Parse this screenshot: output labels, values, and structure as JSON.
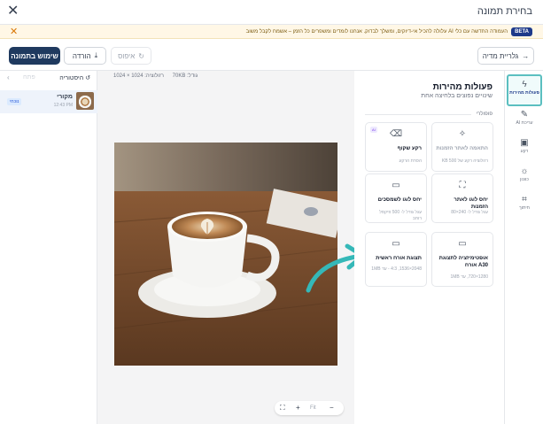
{
  "titlebar": {
    "title": "בחירת תמונה"
  },
  "banner": {
    "badge": "BETA",
    "message": "העמודה החדשה עם כלי AI עלולה להכיל אי-דיוקים, ומשלך לבדוק. אנחנו לומדים ומשפרים כל הזמן – אשמח לקבל משוב"
  },
  "toolbar": {
    "apply_label": "שימוש בתמונה",
    "download_label": "הורדה",
    "reset_label": "איפוס",
    "back_label": "גלריית מדיה"
  },
  "history": {
    "label": "היסטוריה",
    "redo": "פתח",
    "items": [
      {
        "name": "מקורי",
        "time": "12:43 PM",
        "badge": "נוכחי"
      }
    ]
  },
  "canvas": {
    "size_label": "גודל: 70KB",
    "dimensions_label": "רזולוציה: 1024 × 1024",
    "zoom": {
      "level": "Fit",
      "plus": "+",
      "minus": "−",
      "fullscreen": "⛶"
    }
  },
  "actions": {
    "title": "פעולות מהירות",
    "subtitle": "שינויים נפוצים בלחיצה אחת",
    "section": "פופולרי",
    "cards": [
      {
        "icon": "spark-icon",
        "glyph": "✧",
        "name": "התאמה לאתר הזמנות",
        "desc": "רזולוציה רקע של 500 KB",
        "ai": "",
        "dim": true
      },
      {
        "icon": "eraser-icon",
        "glyph": "⌫",
        "name": "רקע שקוף",
        "desc": "הסרת הרקע",
        "ai": "AI",
        "dim": false
      },
      {
        "icon": "crop-icon",
        "glyph": "⛶",
        "name": "יחס לוגו לאתר הזמנות",
        "desc": "עגל גודל ל- 240×80",
        "ai": "",
        "dim": false
      },
      {
        "icon": "frame-icon",
        "glyph": "▭",
        "name": "יחס לוגו לשמסכים",
        "desc": "עגל גודל ל- 500 פיקסל רוחב",
        "ai": "",
        "dim": false
      },
      {
        "icon": "monitor-icon",
        "glyph": "▭",
        "name": "אופטימיזציה לתצוגת A30 אורח",
        "desc": "1280×720, עד 1MB",
        "ai": "",
        "dim": false
      },
      {
        "icon": "tv-icon",
        "glyph": "▭",
        "name": "תצוגת אורח ראשית",
        "desc": "2048×1536, 4:3 - עד 1MB",
        "ai": "",
        "dim": false
      }
    ]
  },
  "rail": [
    {
      "icon": "lightning-icon",
      "glyph": "ϟ",
      "label": "פעולות מהירות",
      "active": true
    },
    {
      "icon": "magic-wand-icon",
      "glyph": "✎",
      "label": "עריכת AI",
      "active": false
    },
    {
      "icon": "image-icon",
      "glyph": "▣",
      "label": "רקע",
      "active": false
    },
    {
      "icon": "sun-icon",
      "glyph": "☼",
      "label": "כוונון",
      "active": false
    },
    {
      "icon": "crop-icon",
      "glyph": "⌗",
      "label": "חיתוך",
      "active": false
    }
  ],
  "colors": {
    "primary": "#1f3a5f",
    "accent_teal": "#35b8b8",
    "banner_bg": "#fff7e6",
    "beta_badge": "#1e3a8a"
  }
}
